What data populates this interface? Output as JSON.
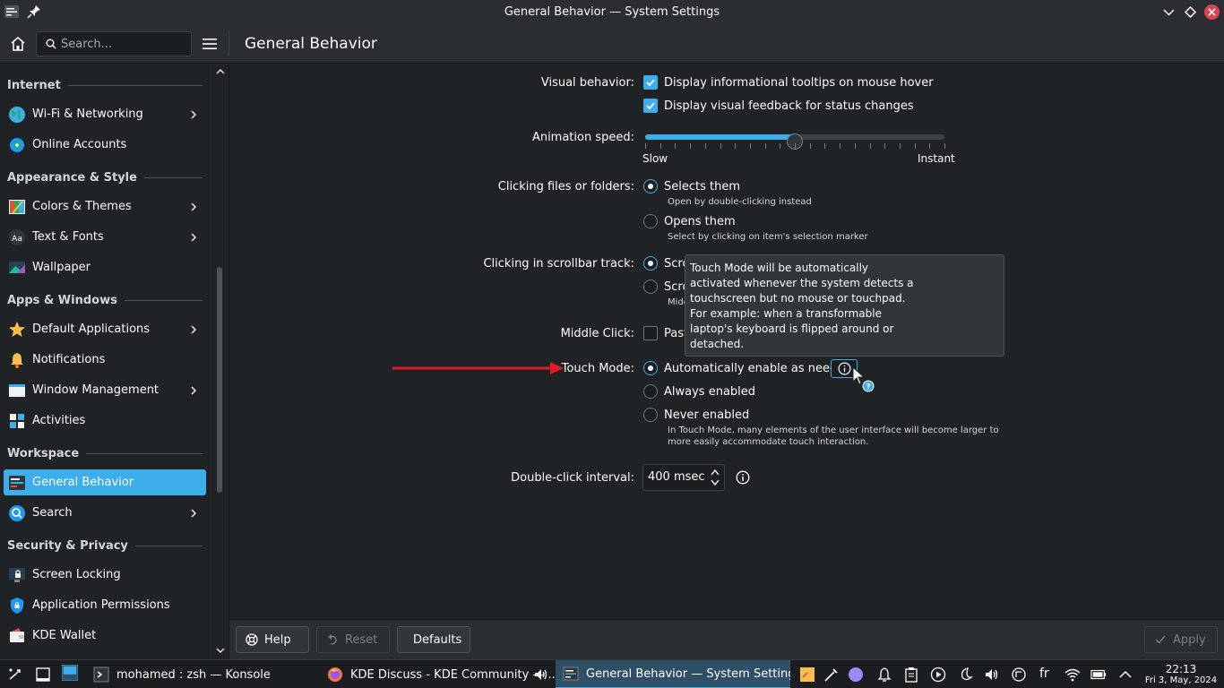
{
  "window": {
    "title": "General Behavior — System Settings"
  },
  "header": {
    "search_placeholder": "Search...",
    "page_title": "General Behavior"
  },
  "sidebar": {
    "categories": {
      "internet": "Internet",
      "appearance": "Appearance & Style",
      "apps": "Apps & Windows",
      "workspace": "Workspace",
      "security": "Security & Privacy"
    },
    "items": [
      {
        "label": "Wi-Fi & Networking",
        "icon": "globe-icon",
        "arrow": true
      },
      {
        "label": "Online Accounts",
        "icon": "online-accounts-icon",
        "arrow": false
      },
      {
        "label": "Colors & Themes",
        "icon": "colors-icon",
        "arrow": true
      },
      {
        "label": "Text & Fonts",
        "icon": "fonts-icon",
        "arrow": true
      },
      {
        "label": "Wallpaper",
        "icon": "wallpaper-icon",
        "arrow": false
      },
      {
        "label": "Default Applications",
        "icon": "star-icon",
        "arrow": true
      },
      {
        "label": "Notifications",
        "icon": "bell-icon",
        "arrow": false
      },
      {
        "label": "Window Management",
        "icon": "window-icon",
        "arrow": true
      },
      {
        "label": "Activities",
        "icon": "activities-icon",
        "arrow": false
      },
      {
        "label": "General Behavior",
        "icon": "general-behavior-icon",
        "arrow": false,
        "selected": true
      },
      {
        "label": "Search",
        "icon": "search-icon",
        "arrow": true
      },
      {
        "label": "Screen Locking",
        "icon": "screen-lock-icon",
        "arrow": false
      },
      {
        "label": "Application Permissions",
        "icon": "shield-icon",
        "arrow": false
      },
      {
        "label": "KDE Wallet",
        "icon": "wallet-icon",
        "arrow": false
      }
    ]
  },
  "main": {
    "visual_behavior": {
      "label": "Visual behavior:",
      "opt1": "Display informational tooltips on mouse hover",
      "opt2": "Display visual feedback for status changes"
    },
    "animation": {
      "label": "Animation speed:",
      "min_label": "Slow",
      "max_label": "Instant",
      "value_fraction": 0.5
    },
    "clicking_files": {
      "label": "Clicking files or folders:",
      "opt1": "Selects them",
      "opt1_hint": "Open by double-clicking instead",
      "opt2": "Opens them",
      "opt2_hint": "Select by clicking on item's selection marker"
    },
    "scrollbar_track": {
      "label": "Clicking in scrollbar track:",
      "opt1": "Scro",
      "opt2": "Scro",
      "opt2_hint": "Midc"
    },
    "middle_click": {
      "label": "Middle Click:",
      "opt1": "Past"
    },
    "touch_mode": {
      "label": "Touch Mode:",
      "opt1": "Automatically enable as needed",
      "opt2": "Always enabled",
      "opt3": "Never enabled",
      "hint1": "In Touch Mode, many elements of the user interface will become larger to",
      "hint2": "more easily accommodate touch interaction."
    },
    "double_click": {
      "label": "Double-click interval:",
      "value": "400 msec"
    },
    "tooltip": {
      "l1": "Touch Mode will be automatically",
      "l2": "activated whenever the system detects a",
      "l3": "touchscreen but no mouse or touchpad.",
      "l4": "For example: when a transformable",
      "l5": "laptop's keyboard is flipped around or",
      "l6": "detached."
    }
  },
  "footer": {
    "help": "Help",
    "reset": "Reset",
    "defaults": "Defaults",
    "apply": "Apply"
  },
  "taskbar": {
    "task1": "mohamed : zsh — Konsole",
    "task2": "KDE Discuss - KDE Community — ...",
    "task3": "General Behavior — System Settings",
    "keyboard_layout": "fr",
    "time": "22:13",
    "date": "Fri 3, May, 2024"
  },
  "colors": {
    "accent": "#3daee9",
    "arrow_red": "#e01b24",
    "close_red": "#da4453"
  }
}
